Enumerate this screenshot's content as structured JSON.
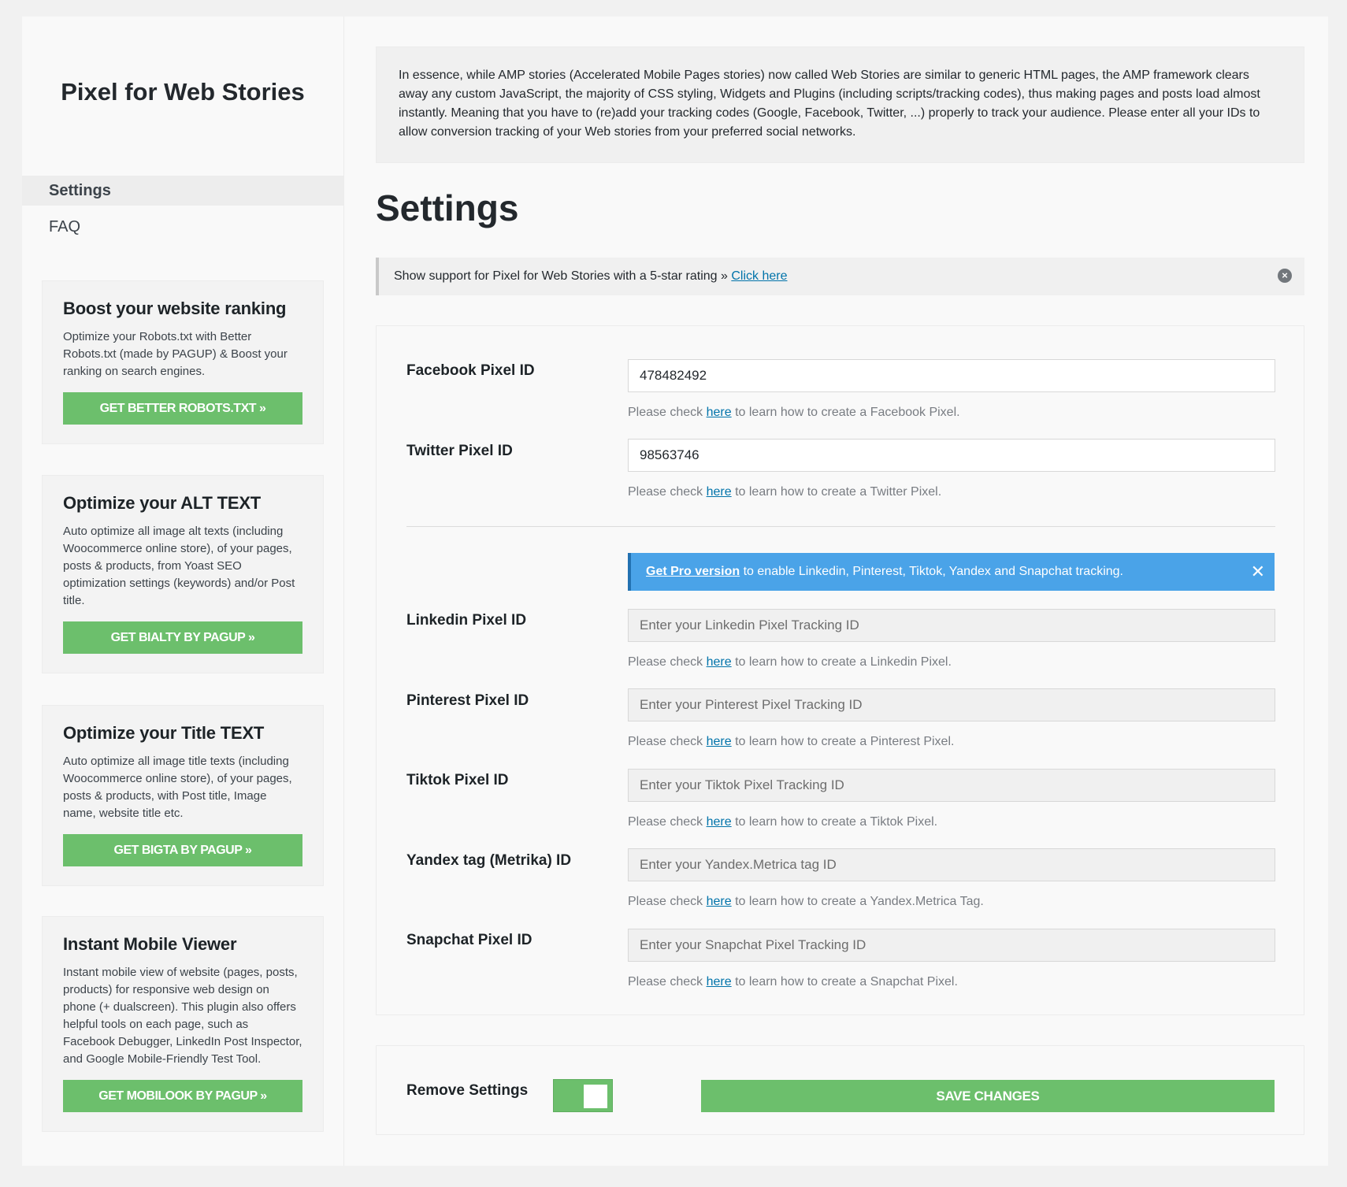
{
  "sidebar": {
    "brand": "Pixel for Web Stories",
    "nav": [
      {
        "label": "Settings",
        "active": true
      },
      {
        "label": "FAQ",
        "active": false
      }
    ],
    "promos": [
      {
        "title": "Boost your website ranking",
        "text": "Optimize your Robots.txt with Better Robots.txt (made by PAGUP) & Boost your ranking on search engines.",
        "button": "GET BETTER ROBOTS.TXT »"
      },
      {
        "title": "Optimize your ALT TEXT",
        "text": "Auto optimize all image alt texts (including Woocommerce online store), of your pages, posts & products, from Yoast SEO optimization settings (keywords) and/or Post title.",
        "button": "GET BIALTY BY PAGUP »"
      },
      {
        "title": "Optimize your Title TEXT",
        "text": "Auto optimize all image title texts (including Woocommerce online store), of your pages, posts & products, with Post title, Image name, website title etc.",
        "button": "GET BIGTA BY PAGUP »"
      },
      {
        "title": "Instant Mobile Viewer",
        "text": "Instant mobile view of website (pages, posts, products) for responsive web design on phone (+ dualscreen). This plugin also offers helpful tools on each page, such as Facebook Debugger, LinkedIn Post Inspector, and Google Mobile-Friendly Test Tool.",
        "button": "GET MOBILOOK BY PAGUP »"
      }
    ]
  },
  "intro": "In essence, while AMP stories (Accelerated Mobile Pages stories) now called Web Stories are similar to generic HTML pages, the AMP framework clears away any custom JavaScript, the majority of CSS styling, Widgets and Plugins (including scripts/tracking codes), thus making pages and posts load almost instantly. Meaning that you have to (re)add your tracking codes (Google, Facebook, Twitter, ...) properly to track your audience. Please enter all your IDs to allow conversion tracking of your Web stories from your preferred social networks.",
  "page_title": "Settings",
  "notice": {
    "text": "Show support for Pixel for Web Stories with a 5-star rating » ",
    "link": "Click here"
  },
  "help": {
    "prefix": "Please check ",
    "link": "here"
  },
  "fields": {
    "facebook": {
      "label": "Facebook Pixel ID",
      "value": "478482492",
      "help_suffix": " to learn how to create a Facebook Pixel."
    },
    "twitter": {
      "label": "Twitter Pixel ID",
      "value": "98563746",
      "help_suffix": " to learn how to create a Twitter Pixel."
    },
    "linkedin": {
      "label": "Linkedin Pixel ID",
      "placeholder": "Enter your Linkedin Pixel Tracking ID",
      "help_suffix": " to learn how to create a Linkedin Pixel."
    },
    "pinterest": {
      "label": "Pinterest Pixel ID",
      "placeholder": "Enter your Pinterest Pixel Tracking ID",
      "help_suffix": " to learn how to create a Pinterest Pixel."
    },
    "tiktok": {
      "label": "Tiktok Pixel ID",
      "placeholder": "Enter your Tiktok Pixel Tracking ID",
      "help_suffix": " to learn how to create a Tiktok Pixel."
    },
    "yandex": {
      "label": "Yandex tag (Metrika) ID",
      "placeholder": "Enter your Yandex.Metrica tag ID",
      "help_suffix": " to learn how to create a Yandex.Metrica Tag."
    },
    "snapchat": {
      "label": "Snapchat Pixel ID",
      "placeholder": "Enter your Snapchat Pixel Tracking ID",
      "help_suffix": " to learn how to create a Snapchat Pixel."
    }
  },
  "pro_notice": {
    "link": "Get Pro version",
    "text": " to enable Linkedin, Pinterest, Tiktok, Yandex and Snapchat tracking.",
    "close": "✕"
  },
  "footer": {
    "remove_label": "Remove Settings",
    "save_label": "SAVE CHANGES"
  },
  "colors": {
    "green": "#6cbf6c",
    "blue": "#4aa3e8",
    "link": "#0073aa"
  }
}
